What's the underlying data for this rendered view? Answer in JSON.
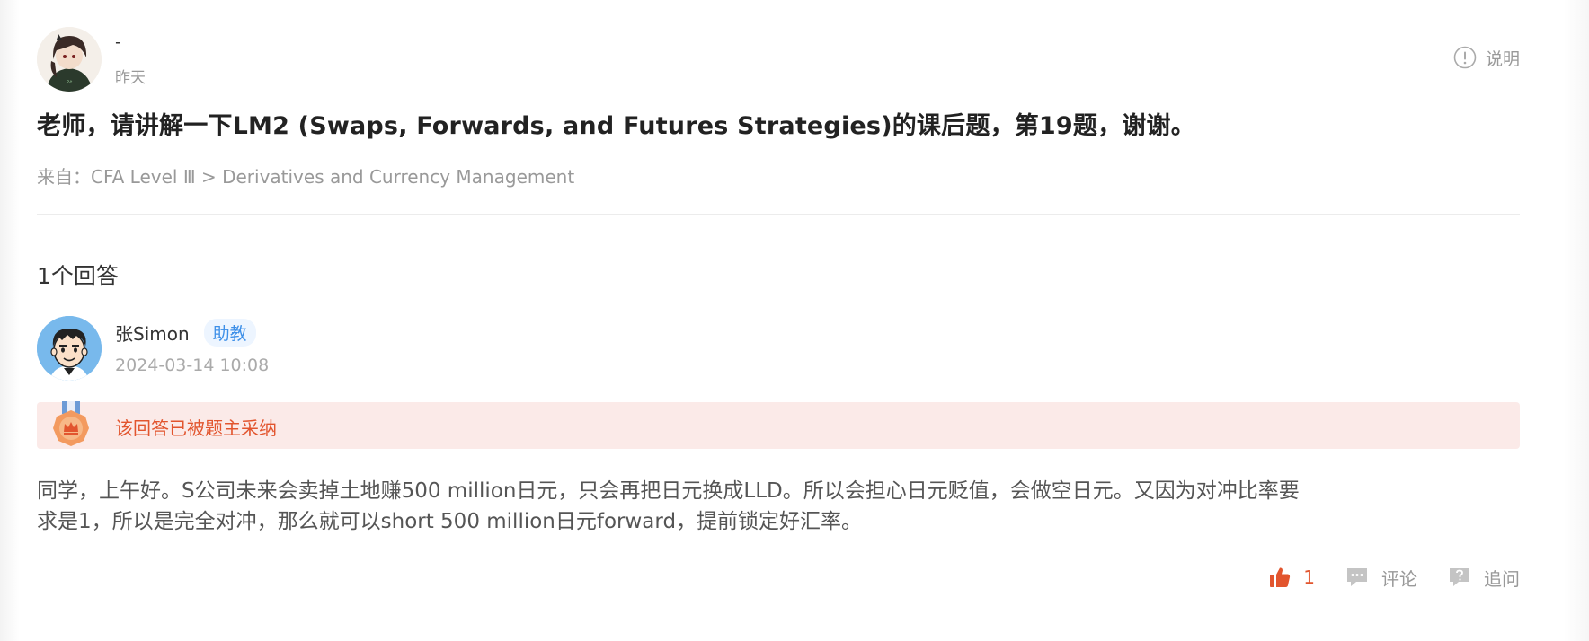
{
  "question": {
    "user_name": "-",
    "time": "昨天",
    "explain_label": "说明",
    "title": "老师，请讲解一下LM2 (Swaps, Forwards, and Futures Strategies)的课后题，第19题，谢谢。",
    "from": "来自：CFA Level Ⅲ > Derivatives and Currency Management"
  },
  "answers": {
    "count_label": "1个回答",
    "items": [
      {
        "author": "张Simon",
        "badge": "助教",
        "time": "2024-03-14 10:08",
        "accepted_label": "该回答已被题主采纳",
        "body_line1": "同学，上午好。S公司未来会卖掉土地赚500 million日元，只会再把日元换成LLD。所以会担心日元贬值，会做空日元。又因为对冲比率要",
        "body_line2": "求是1，所以是完全对冲，那么就可以short 500 million日元forward，提前锁定好汇率。",
        "likes": "1",
        "comment_label": "评论",
        "followup_label": "追问"
      }
    ]
  },
  "icons": {
    "explain": "info-circle-icon",
    "medal": "medal-crown-icon",
    "like": "thumbs-up-icon",
    "comment": "comment-icon",
    "followup": "question-bubble-icon"
  },
  "colors": {
    "accent": "#e2552e",
    "accepted_bg": "#fbeae8",
    "badge_text": "#3d8fe8",
    "badge_bg": "#edf5ff",
    "muted": "#999999"
  }
}
